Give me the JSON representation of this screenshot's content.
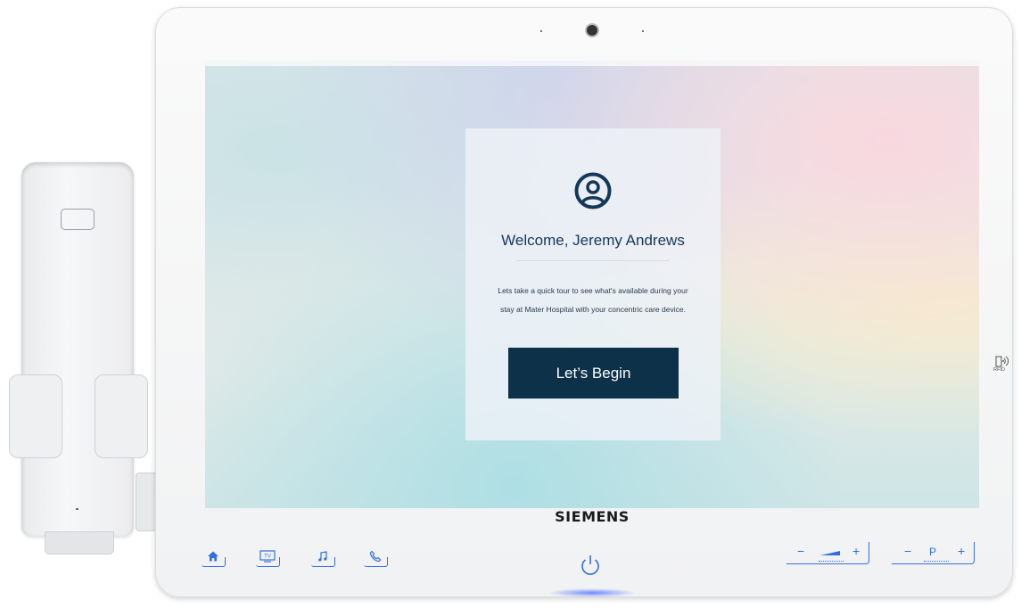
{
  "device": {
    "brand": "SIEMENS",
    "rfid_label": "RFID"
  },
  "welcome_card": {
    "title": "Welcome, Jeremy Andrews",
    "intro": "Lets take a quick tour to see what's available during your stay at Mater Hospital with your concentric care device.",
    "begin_label": "Let’s Begin"
  },
  "hardware_buttons": {
    "tv_label": "TV",
    "volume": {
      "minus": "−",
      "plus": "+"
    },
    "channel": {
      "minus": "−",
      "label": "P",
      "plus": "+"
    }
  },
  "colors": {
    "button_dark": "#0d3148",
    "title_navy": "#14385a",
    "touch_blue": "#2f6fe6"
  },
  "icons": [
    "user-circle-icon",
    "home-icon",
    "tv-icon",
    "music-note-icon",
    "phone-icon",
    "power-icon",
    "rfid-icon"
  ]
}
